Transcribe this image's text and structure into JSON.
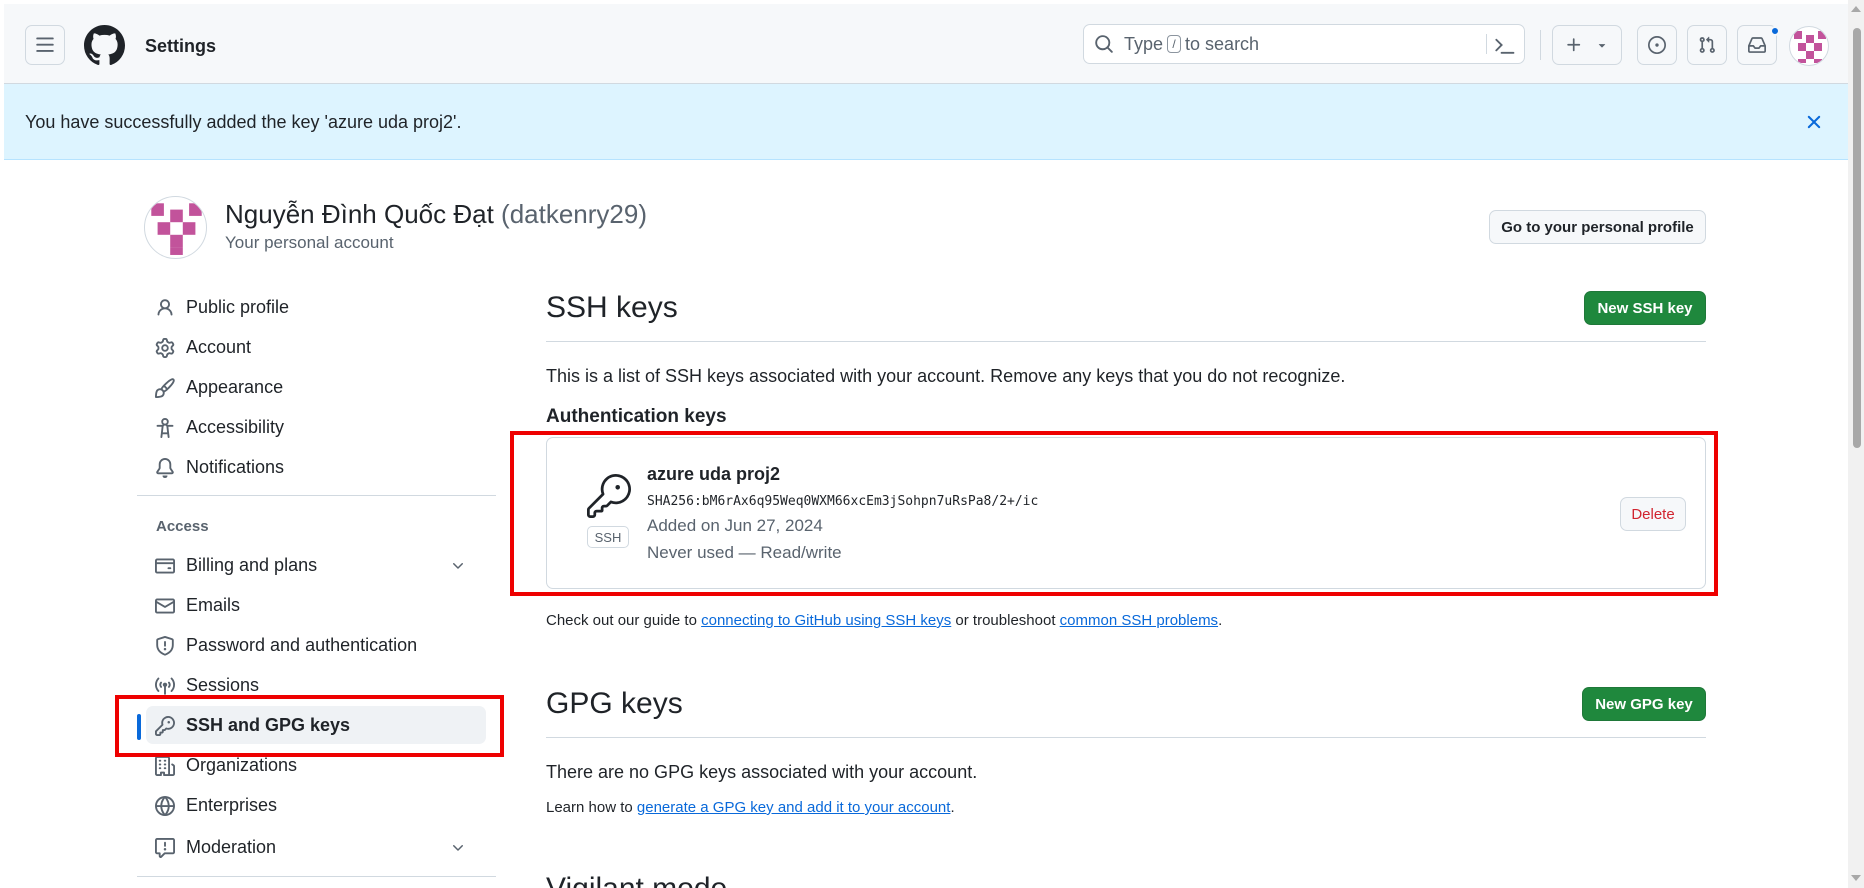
{
  "header": {
    "title": "Settings",
    "search": {
      "prefix": "Type",
      "kbd": "/",
      "suffix": "to search"
    },
    "icons": [
      "hamburger-icon",
      "github-logo",
      "search-icon",
      "command-palette-icon",
      "plus-icon",
      "issues-icon",
      "pull-requests-icon",
      "inbox-icon",
      "avatar"
    ]
  },
  "flash": {
    "message": "You have successfully added the key 'azure uda proj2'."
  },
  "account": {
    "name": "Nguyễn Đình Quốc Đạt",
    "handle": "(datkenry29)",
    "subtitle": "Your personal account",
    "profile_button": "Go to your personal profile"
  },
  "sidebar": {
    "items": [
      {
        "label": "Public profile",
        "icon": "person-icon"
      },
      {
        "label": "Account",
        "icon": "gear-icon"
      },
      {
        "label": "Appearance",
        "icon": "paintbrush-icon"
      },
      {
        "label": "Accessibility",
        "icon": "accessibility-icon"
      },
      {
        "label": "Notifications",
        "icon": "bell-icon"
      }
    ],
    "access_heading": "Access",
    "access_items": [
      {
        "label": "Billing and plans",
        "icon": "credit-card-icon"
      },
      {
        "label": "Emails",
        "icon": "mail-icon"
      },
      {
        "label": "Password and authentication",
        "icon": "shield-icon"
      },
      {
        "label": "Sessions",
        "icon": "broadcast-icon"
      },
      {
        "label": "SSH and GPG keys",
        "icon": "key-icon"
      },
      {
        "label": "Organizations",
        "icon": "organization-icon"
      },
      {
        "label": "Enterprises",
        "icon": "globe-icon"
      },
      {
        "label": "Moderation",
        "icon": "report-icon"
      }
    ]
  },
  "ssh": {
    "title": "SSH keys",
    "new_button": "New SSH key",
    "description": "This is a list of SSH keys associated with your account. Remove any keys that you do not recognize.",
    "subheading": "Authentication keys",
    "key": {
      "title": "azure uda proj2",
      "fingerprint": "SHA256:bM6rAx6q95Weq0WXM66xcEm3jSohpn7uRsPa8/2+/ic",
      "added": "Added on Jun 27, 2024",
      "usage": "Never used — Read/write",
      "tag": "SSH",
      "delete_button": "Delete"
    },
    "guide": {
      "prefix": "Check out our guide to",
      "link1": "connecting to GitHub using SSH keys",
      "middle": "or troubleshoot",
      "link2": "common SSH problems",
      "suffix": "."
    }
  },
  "gpg": {
    "title": "GPG keys",
    "new_button": "New GPG key",
    "empty": "There are no GPG keys associated with your account.",
    "learn": {
      "prefix": "Learn how to",
      "link": "generate a GPG key and add it to your account",
      "suffix": "."
    }
  },
  "vigilant": {
    "title": "Vigilant mode"
  },
  "colors": {
    "primary_green": "#1f883d",
    "link_blue": "#0969da",
    "flash_bg": "#ddf4ff",
    "danger": "#d1242f",
    "highlight": "#ee0000"
  }
}
